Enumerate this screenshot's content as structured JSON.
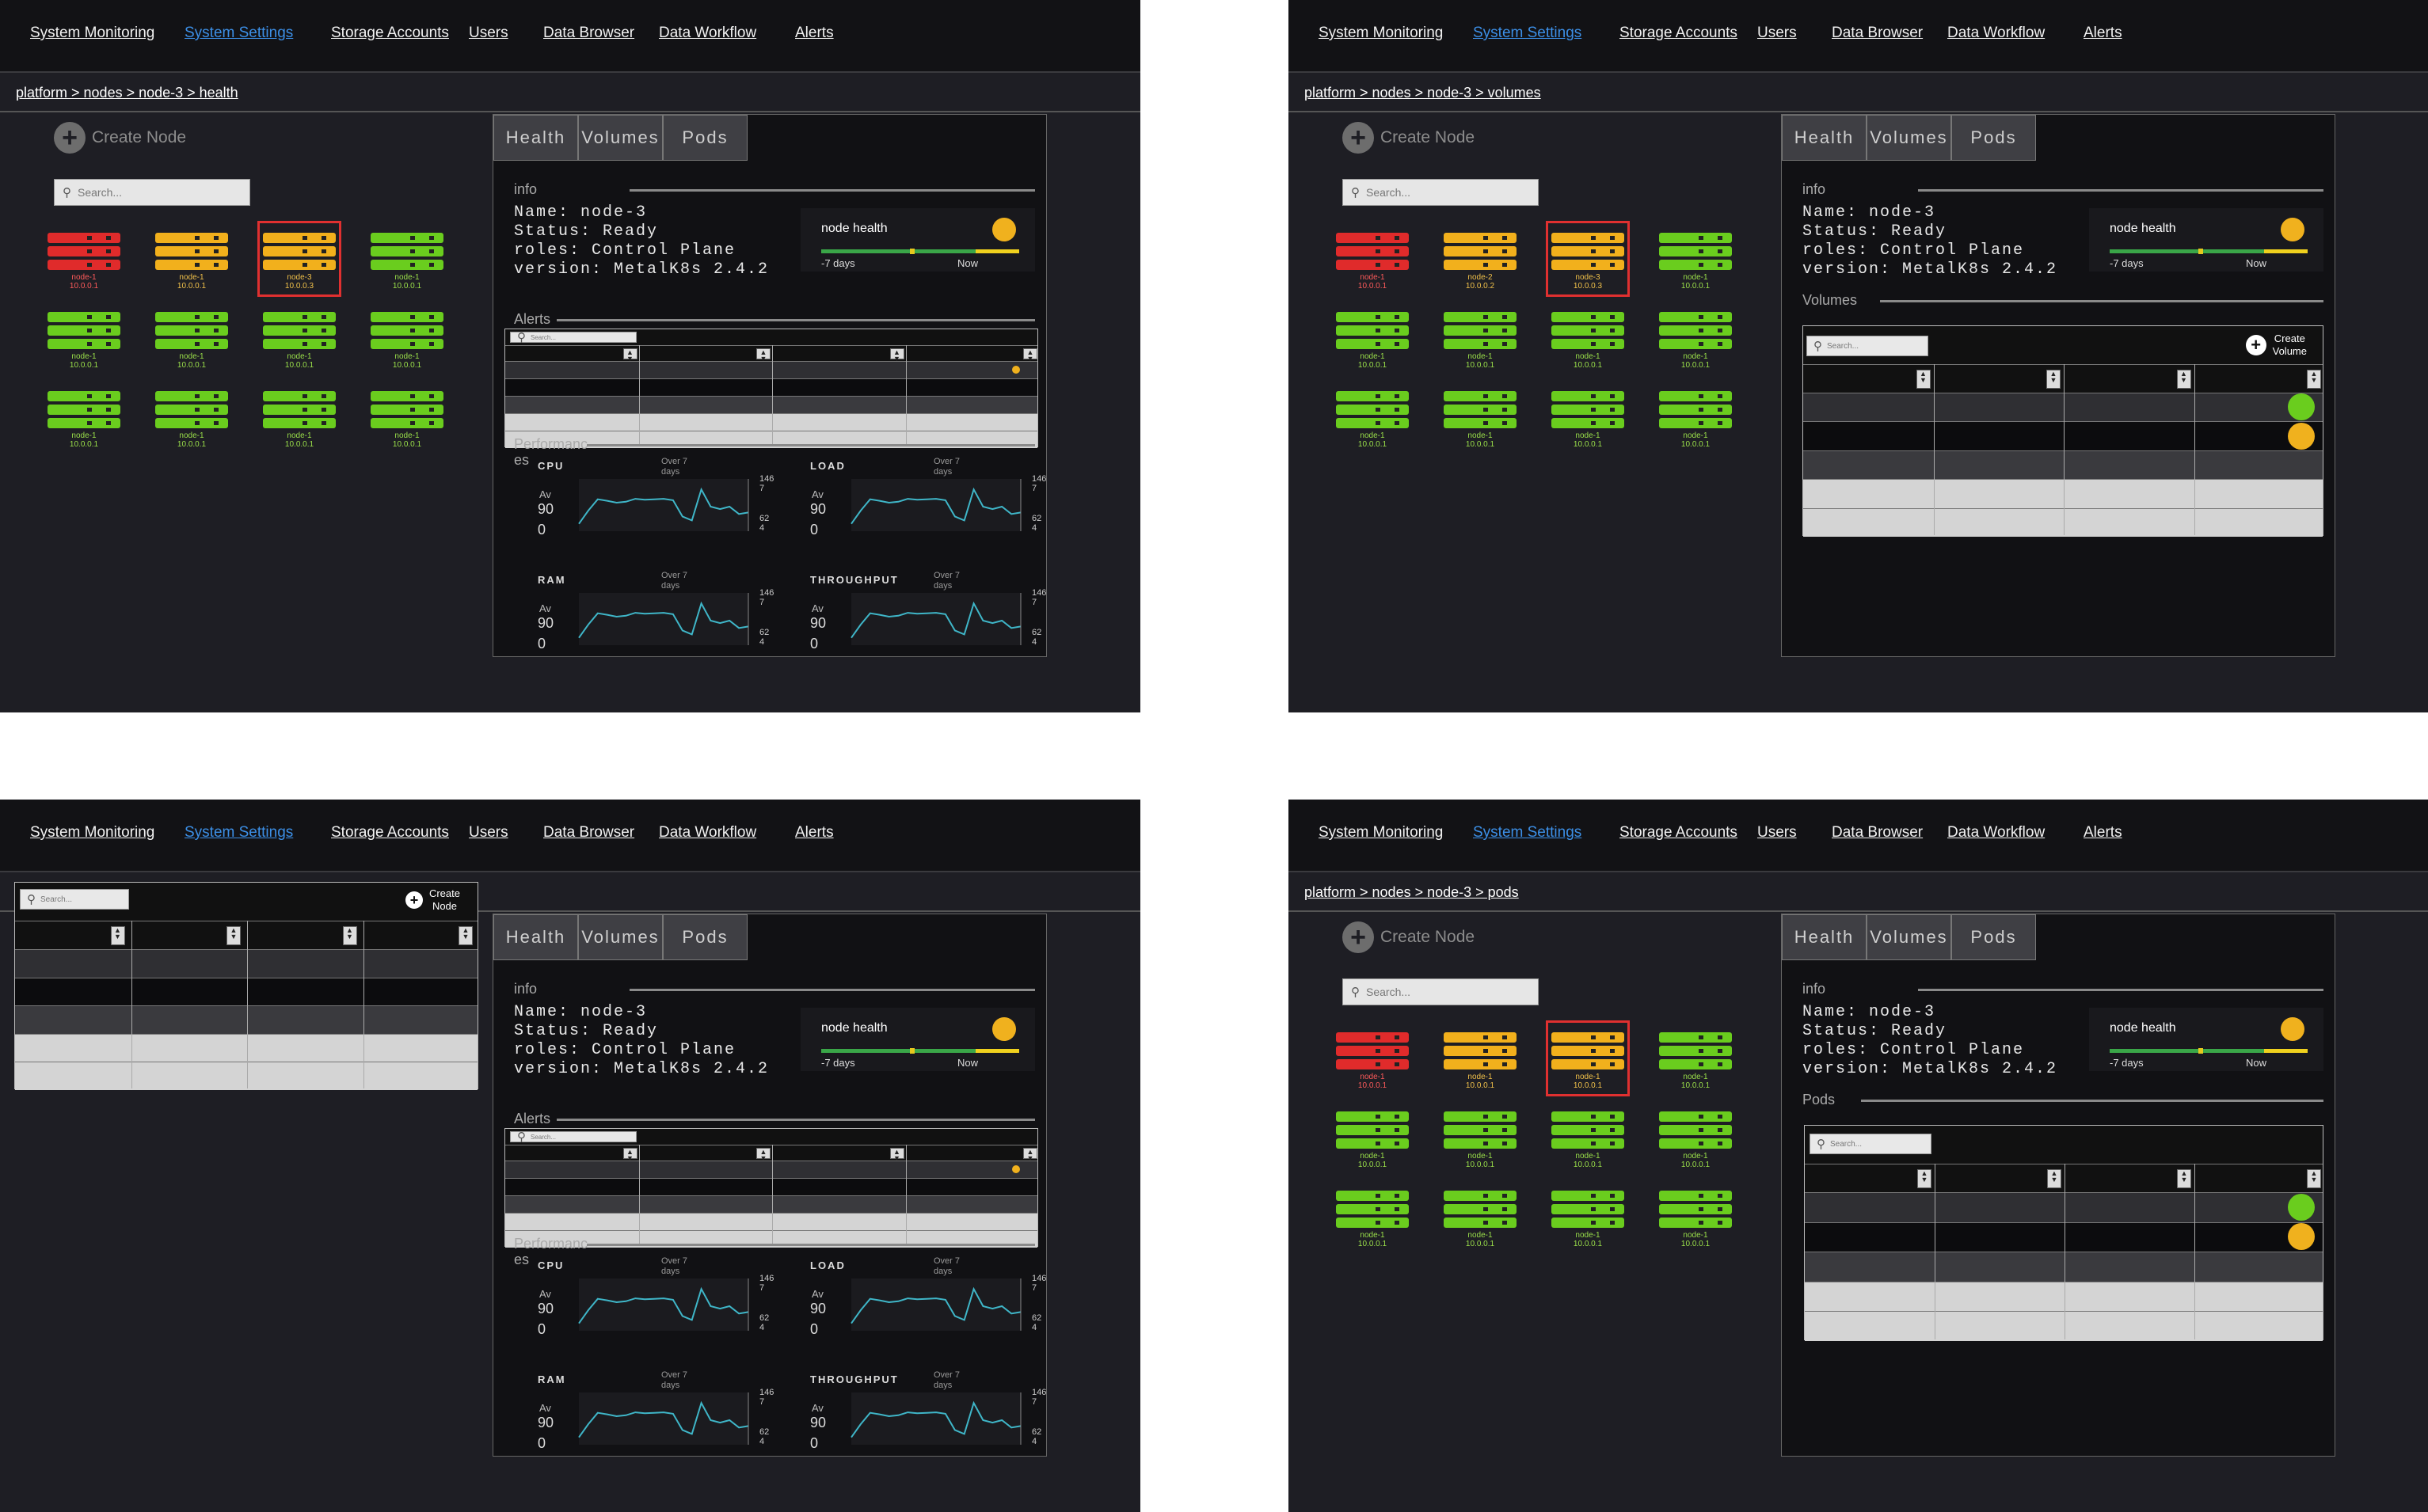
{
  "nav": {
    "items": [
      "System Monitoring",
      "System Settings",
      "Storage Accounts",
      "Users",
      "Data Browser",
      "Data Workflow",
      "Alerts"
    ],
    "active": "System Settings"
  },
  "screens": [
    {
      "id": "s1",
      "breadcrumb": "platform > nodes > node-3 > health",
      "view": "health"
    },
    {
      "id": "s2",
      "breadcrumb": "platform > nodes > node-3 > volumes",
      "view": "volumes"
    },
    {
      "id": "s3",
      "breadcrumb": "platform > nodes > node-3 > health",
      "view": "health-table"
    },
    {
      "id": "s4",
      "breadcrumb": "platform > nodes > node-3 > pods",
      "view": "pods"
    }
  ],
  "create_node": "Create Node",
  "create_node_small": [
    "Create",
    "Node"
  ],
  "create_volume": [
    "Create",
    "Volume"
  ],
  "search_placeholder": "Search...",
  "tabs": [
    "Health",
    "Volumes",
    "Pods"
  ],
  "info": {
    "heading": "info",
    "lines": [
      "Name: node-3",
      "Status: Ready",
      "roles: Control Plane",
      "version: MetalK8s 2.4.2"
    ]
  },
  "node_health": {
    "label": "node health",
    "axis_left": "-7 days",
    "axis_right": "Now",
    "status_color": "#f0b11e"
  },
  "sections": {
    "alerts": "Alerts",
    "performance": [
      "Performanc",
      "es"
    ],
    "volumes": "Volumes",
    "pods": "Pods"
  },
  "metrics": [
    {
      "name": "CPU",
      "period": [
        "Over 7",
        "days"
      ],
      "avg_label": "Av",
      "value": "90",
      "zero": "0",
      "ymax": [
        "146",
        "7"
      ],
      "ymin": [
        "62",
        "4"
      ]
    },
    {
      "name": "LOAD",
      "period": [
        "Over 7",
        "days"
      ],
      "avg_label": "Av",
      "value": "90",
      "zero": "0",
      "ymax": [
        "146",
        "7"
      ],
      "ymin": [
        "62",
        "4"
      ]
    },
    {
      "name": "RAM",
      "period": [
        "Over 7",
        "days"
      ],
      "avg_label": "Av",
      "value": "90",
      "zero": "0",
      "ymax": [
        "146",
        "7"
      ],
      "ymin": [
        "62",
        "4"
      ]
    },
    {
      "name": "THROUGHPUT",
      "period": [
        "Over 7",
        "days"
      ],
      "avg_label": "Av",
      "value": "90",
      "zero": "0",
      "ymax": [
        "146",
        "7"
      ],
      "ymin": [
        "62",
        "4"
      ]
    }
  ],
  "sparkline": [
    0.15,
    0.42,
    0.65,
    0.62,
    0.58,
    0.6,
    0.66,
    0.64,
    0.65,
    0.66,
    0.63,
    0.3,
    0.22,
    0.85,
    0.5,
    0.45,
    0.5,
    0.35,
    0.38
  ],
  "node_grids": {
    "s1": [
      [
        "r",
        "node-1",
        "10.0.0.1"
      ],
      [
        "y",
        "node-1",
        "10.0.0.1"
      ],
      [
        "y",
        "node-3",
        "10.0.0.3"
      ],
      [
        "g",
        "node-1",
        "10.0.0.1"
      ],
      [
        "g",
        "node-1",
        "10.0.0.1"
      ],
      [
        "g",
        "node-1",
        "10.0.0.1"
      ],
      [
        "g",
        "node-1",
        "10.0.0.1"
      ],
      [
        "g",
        "node-1",
        "10.0.0.1"
      ],
      [
        "g",
        "node-1",
        "10.0.0.1"
      ],
      [
        "g",
        "node-1",
        "10.0.0.1"
      ],
      [
        "g",
        "node-1",
        "10.0.0.1"
      ],
      [
        "g",
        "node-1",
        "10.0.0.1"
      ]
    ],
    "s2": [
      [
        "r",
        "node-1",
        "10.0.0.1"
      ],
      [
        "y",
        "node-2",
        "10.0.0.2"
      ],
      [
        "y",
        "node-3",
        "10.0.0.3"
      ],
      [
        "g",
        "node-1",
        "10.0.0.1"
      ],
      [
        "g",
        "node-1",
        "10.0.0.1"
      ],
      [
        "g",
        "node-1",
        "10.0.0.1"
      ],
      [
        "g",
        "node-1",
        "10.0.0.1"
      ],
      [
        "g",
        "node-1",
        "10.0.0.1"
      ],
      [
        "g",
        "node-1",
        "10.0.0.1"
      ],
      [
        "g",
        "node-1",
        "10.0.0.1"
      ],
      [
        "g",
        "node-1",
        "10.0.0.1"
      ],
      [
        "g",
        "node-1",
        "10.0.0.1"
      ]
    ],
    "s4": [
      [
        "r",
        "node-1",
        "10.0.0.1"
      ],
      [
        "y",
        "node-1",
        "10.0.0.1"
      ],
      [
        "y",
        "node-1",
        "10.0.0.1"
      ],
      [
        "g",
        "node-1",
        "10.0.0.1"
      ],
      [
        "g",
        "node-1",
        "10.0.0.1"
      ],
      [
        "g",
        "node-1",
        "10.0.0.1"
      ],
      [
        "g",
        "node-1",
        "10.0.0.1"
      ],
      [
        "g",
        "node-1",
        "10.0.0.1"
      ],
      [
        "g",
        "node-1",
        "10.0.0.1"
      ],
      [
        "g",
        "node-1",
        "10.0.0.1"
      ],
      [
        "g",
        "node-1",
        "10.0.0.1"
      ],
      [
        "g",
        "node-1",
        "10.0.0.1"
      ]
    ]
  },
  "selected_node_index": 2,
  "status_colors": {
    "ok": "#6acd1e",
    "warning": "#f0b11e",
    "critical": "#e02b2b"
  }
}
